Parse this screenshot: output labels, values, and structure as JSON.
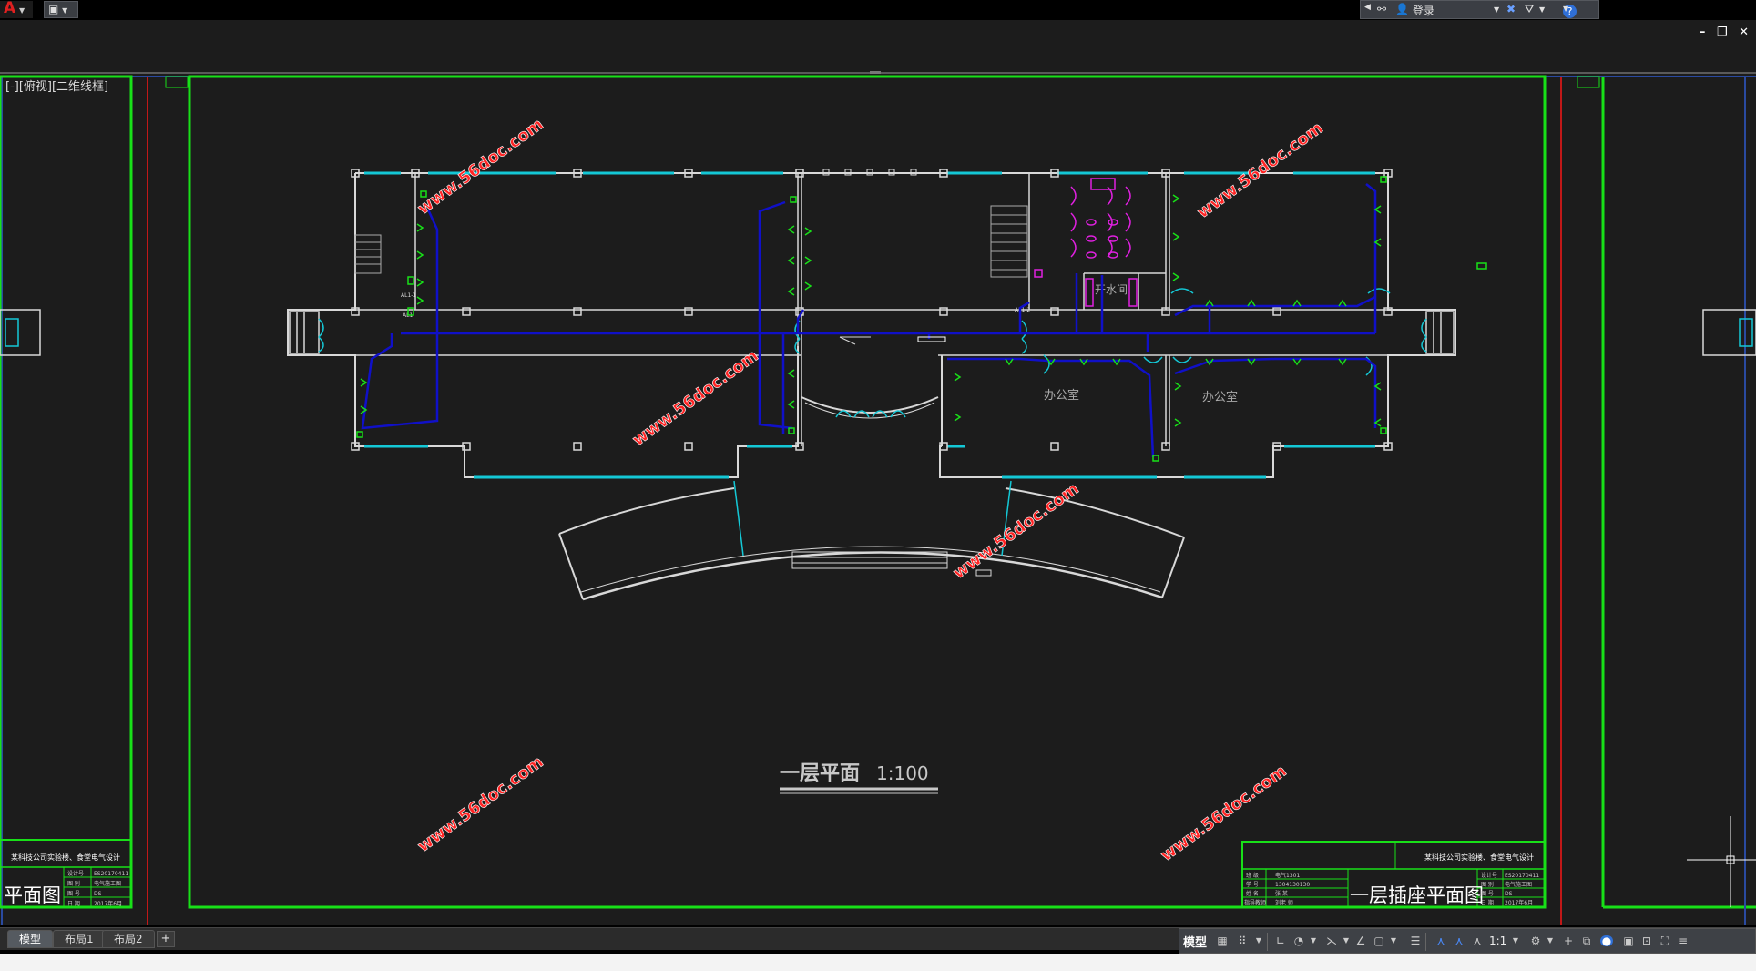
{
  "app": {
    "logo_text": "A",
    "quick_access_icon": "qat-icon",
    "login_label": "登录",
    "help_label": "?",
    "window_controls": [
      "–",
      "❐",
      "✕"
    ]
  },
  "viewport": {
    "label": "[-][俯视][二维线框]",
    "plan_title": "一层平面",
    "plan_scale": "1:100",
    "room_labels": [
      "办公室",
      "办公室",
      "开水间"
    ],
    "panel_labels": [
      "AL1-1",
      "AL1",
      "AL1-2"
    ],
    "watermark": "www.56doc.com",
    "colors": {
      "background": "#1c1c1c",
      "wall": "#d8d8d8",
      "window": "#14c8d6",
      "wire": "#1010c8",
      "frame": "#18e018",
      "sanitary": "#e020e0"
    }
  },
  "title_blocks": {
    "left": {
      "project": "某科技公司实验楼、食堂电气设计",
      "drawing_name": "平面图",
      "rows": [
        [
          "设计号",
          "ES20170411"
        ],
        [
          "图 别",
          "电气施工图"
        ],
        [
          "图 号",
          "DS"
        ],
        [
          "日 期",
          "2017年6月"
        ]
      ]
    },
    "right": {
      "project": "某科技公司实验楼、食堂电气设计",
      "drawing_name": "一层插座平面图",
      "left_rows": [
        [
          "班 级",
          "电气1301"
        ],
        [
          "学 号",
          "1304130130"
        ],
        [
          "姓 名",
          "张 某"
        ],
        [
          "指导教师",
          "刘老 师"
        ]
      ],
      "rows": [
        [
          "设计号",
          "ES20170411"
        ],
        [
          "图 别",
          "电气施工图"
        ],
        [
          "图 号",
          "DS"
        ],
        [
          "日 期",
          "2017年6月"
        ]
      ]
    }
  },
  "layout_tabs": [
    "模型",
    "布局1",
    "布局2"
  ],
  "add_tab": "+",
  "statusbar": {
    "model_label": "模型",
    "scale": "1:1"
  }
}
